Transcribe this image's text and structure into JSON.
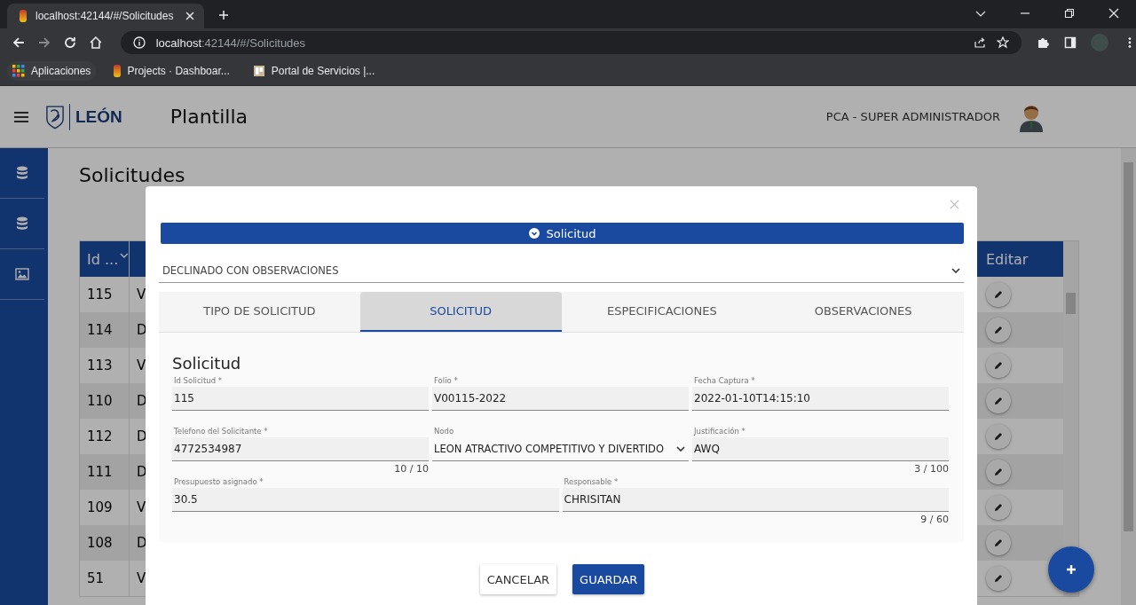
{
  "browser": {
    "tab_title": "localhost:42144/#/Solicitudes",
    "url_host": "localhost",
    "url_path": ":42144/#/Solicitudes",
    "bookmarks": [
      {
        "label": "Aplicaciones",
        "kind": "apps"
      },
      {
        "label": "Projects · Dashboar...",
        "kind": "figure"
      },
      {
        "label": "Portal de Servicios |...",
        "kind": "page"
      }
    ]
  },
  "header": {
    "logo_text": "LEÓN",
    "title": "Plantilla",
    "user": "PCA - SUPER ADMINISTRADOR"
  },
  "sidebar": {
    "items": [
      {
        "kind": "database"
      },
      {
        "kind": "database"
      },
      {
        "kind": "image"
      }
    ]
  },
  "page": {
    "title": "Solicitudes"
  },
  "table": {
    "columns": [
      "Id ...",
      "Editar"
    ],
    "rows": [
      {
        "id": "115",
        "column_2": "V"
      },
      {
        "id": "114",
        "column_2": "D"
      },
      {
        "id": "113",
        "column_2": "V"
      },
      {
        "id": "110",
        "column_2": "D"
      },
      {
        "id": "112",
        "column_2": "D"
      },
      {
        "id": "111",
        "column_2": "D"
      },
      {
        "id": "109",
        "column_2": "V"
      },
      {
        "id": "108",
        "column_2": "D"
      },
      {
        "id": "51",
        "column_2": "V"
      }
    ]
  },
  "modal": {
    "section_title": "Solicitud",
    "status": "DECLINADO CON OBSERVACIONES",
    "tabs": [
      {
        "label": "TIPO DE SOLICITUD",
        "selected": false
      },
      {
        "label": "SOLICITUD",
        "selected": true
      },
      {
        "label": "ESPECIFICACIONES",
        "selected": false
      },
      {
        "label": "OBSERVACIONES",
        "selected": false
      }
    ],
    "form_title": "Solicitud",
    "rows": [
      [
        {
          "kind": "input",
          "label": "Id Solicitud *",
          "value": "115"
        },
        {
          "kind": "input",
          "label": "Folio *",
          "value": "V00115-2022"
        },
        {
          "kind": "input",
          "label": "Fecha Captura *",
          "value": "2022-01-10T14:15:10"
        }
      ],
      [
        {
          "kind": "input",
          "label": "Telefono del Solicitante *",
          "value": "4772534987",
          "counter": "10 / 10"
        },
        {
          "kind": "select",
          "label": "Nodo",
          "value": "LEON ATRACTIVO COMPETITIVO Y DIVERTIDO"
        },
        {
          "kind": "input",
          "label": "Justificación *",
          "value": "AWQ",
          "counter": "3 / 100"
        }
      ],
      [
        {
          "kind": "input",
          "label": "Presupuesto asignado *",
          "value": "30.5"
        },
        {
          "kind": "input",
          "label": "Responsable *",
          "value": "CHRISITAN",
          "counter": "9 / 60"
        }
      ]
    ],
    "buttons": [
      {
        "label": "CANCELAR",
        "kind": "secondary"
      },
      {
        "label": "GUARDAR",
        "kind": "primary"
      }
    ]
  }
}
